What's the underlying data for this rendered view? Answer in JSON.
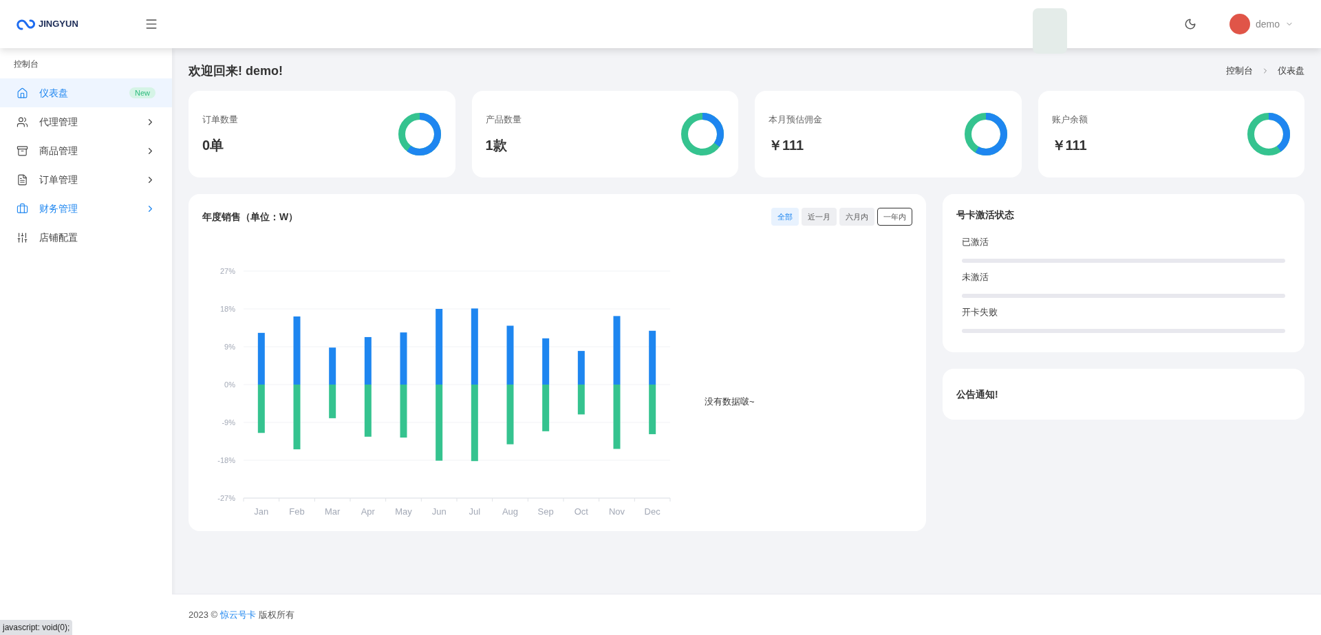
{
  "header": {
    "logo_text": "JINGYUN",
    "user": {
      "name": "demo"
    }
  },
  "sidebar": {
    "section_title": "控制台",
    "items": [
      {
        "label": "仪表盘",
        "selected": true,
        "hovered": false,
        "badge": "New",
        "has_children": false
      },
      {
        "label": "代理管理",
        "selected": false,
        "hovered": false,
        "has_children": true
      },
      {
        "label": "商品管理",
        "selected": false,
        "hovered": false,
        "has_children": true
      },
      {
        "label": "订单管理",
        "selected": false,
        "hovered": false,
        "has_children": true
      },
      {
        "label": "财务管理",
        "selected": false,
        "hovered": true,
        "has_children": true
      },
      {
        "label": "店铺配置",
        "selected": false,
        "hovered": false,
        "has_children": false
      }
    ]
  },
  "page": {
    "title": "欢迎回来! demo!",
    "breadcrumb": [
      "控制台",
      "仪表盘"
    ]
  },
  "stat_cards": [
    {
      "label": "订单数量",
      "value": "0单"
    },
    {
      "label": "产品数量",
      "value": "1款"
    },
    {
      "label": "本月预估佣金",
      "value": "￥111"
    },
    {
      "label": "账户余额",
      "value": "￥111"
    }
  ],
  "sales_card": {
    "title": "年度销售（单位：W）",
    "filters": [
      {
        "label": "全部",
        "selected": true,
        "focused": false
      },
      {
        "label": "近一月",
        "selected": false,
        "focused": false
      },
      {
        "label": "六月内",
        "selected": false,
        "focused": false
      },
      {
        "label": "一年内",
        "selected": false,
        "focused": true
      }
    ],
    "chart_data": {
      "type": "bar",
      "categories": [
        "Jan",
        "Feb",
        "Mar",
        "Apr",
        "May",
        "Jun",
        "Jul",
        "Aug",
        "Sep",
        "Oct",
        "Nov",
        "Dec"
      ],
      "series": [
        {
          "color": "#1e86f0",
          "values": [
            12.3,
            16.2,
            8.8,
            11.3,
            12.4,
            18,
            18.1,
            14,
            11,
            8,
            16.3,
            12.8
          ]
        },
        {
          "color": "#35c38f",
          "values": [
            -11.5,
            -15.4,
            -8,
            -12.4,
            -12.6,
            -18.1,
            -18.2,
            -14.2,
            -11.1,
            -7.1,
            -15.3,
            -11.8
          ]
        }
      ],
      "ylim": [
        -27,
        27
      ],
      "yticks": [
        {
          "value": -27,
          "label": "-27%"
        },
        {
          "value": -18,
          "label": "-18%"
        },
        {
          "value": -9,
          "label": "-9%"
        },
        {
          "value": 0,
          "label": "0%"
        },
        {
          "value": 9,
          "label": "9%"
        },
        {
          "value": 18,
          "label": "18%"
        },
        {
          "value": 27,
          "label": "27%"
        }
      ],
      "stacked": true,
      "grid": true
    },
    "empty_text": "没有数据啵~"
  },
  "activation_card": {
    "title": "号卡激活状态",
    "rows": [
      {
        "label": "已激活",
        "level": 0
      },
      {
        "label": "未激活",
        "level": 0
      },
      {
        "label": "开卡失败",
        "level": 0
      }
    ]
  },
  "notice_card": {
    "title": "公告通知!"
  },
  "footer": {
    "prefix": "2023 ©",
    "link": "惊云号卡",
    "suffix": "版权所有"
  },
  "status_bar": "javascript: void(0);"
}
